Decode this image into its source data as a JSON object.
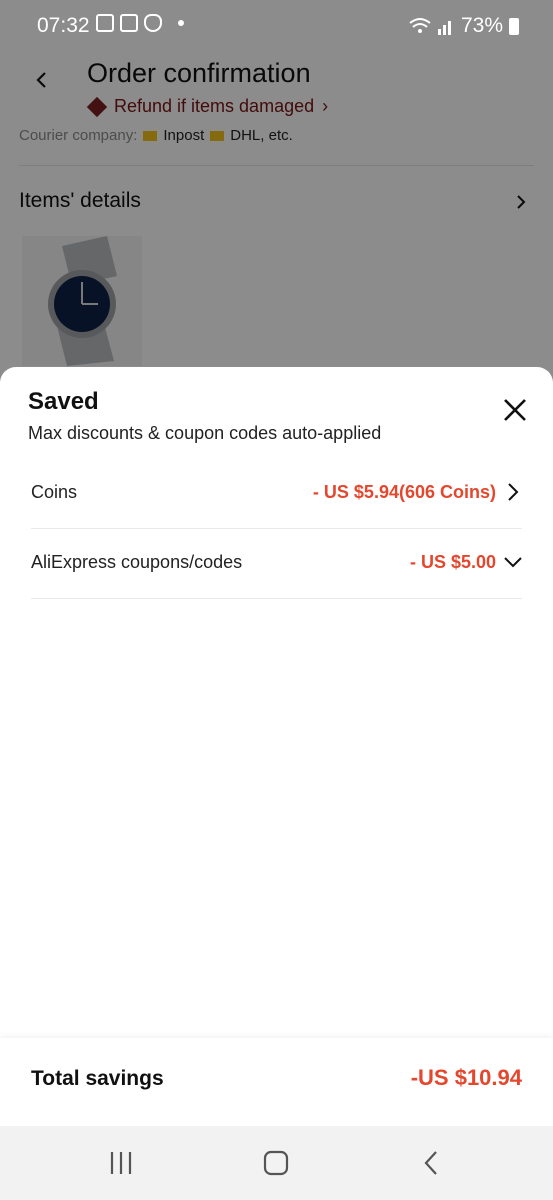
{
  "status_bar": {
    "time": "07:32",
    "battery": "73%"
  },
  "background_page": {
    "title": "Order confirmation",
    "refund_text": "Refund if items damaged",
    "courier_prefix": "Courier company:",
    "courier_1": "Inpost",
    "courier_2": "DHL, etc.",
    "items_title": "Items' details"
  },
  "sheet": {
    "title": "Saved",
    "subtitle": "Max discounts & coupon codes auto-applied",
    "rows": [
      {
        "label": "Coins",
        "value": "- US $5.94(606 Coins)",
        "icon": "chevron-right-icon"
      },
      {
        "label": "AliExpress coupons/codes",
        "value": "- US $5.00",
        "icon": "chevron-down-icon"
      }
    ],
    "total_label": "Total savings",
    "total_value": "-US $10.94"
  },
  "colors": {
    "accent_red": "#e4472d",
    "refund_text": "#7b1414"
  }
}
